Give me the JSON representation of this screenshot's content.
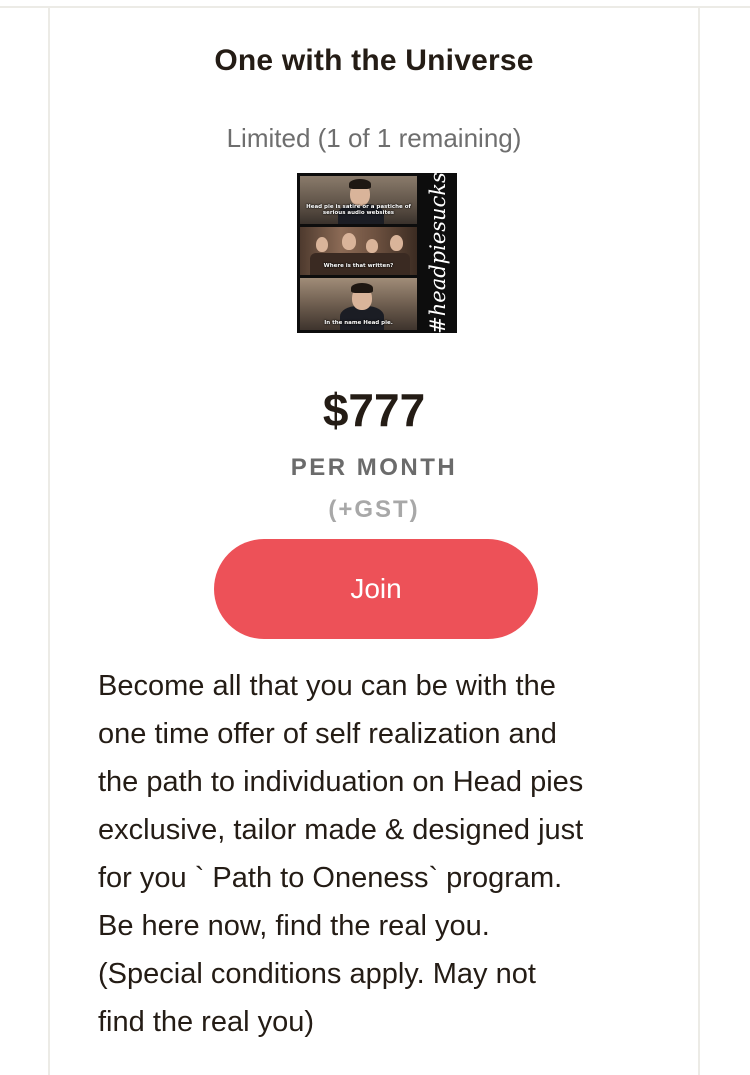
{
  "tier": {
    "title": "One with the Universe",
    "availability": "Limited (1 of 1 remaining)",
    "image": {
      "captions": [
        "Head pie is satire or a pastiche of serious audio websites",
        "Where is that written?",
        "In the name Head pie."
      ],
      "hashtag": "#headpiesucks"
    },
    "price": "$777",
    "period": "PER MONTH",
    "tax_note": "(+GST)",
    "join_label": "Join",
    "description": "Become all that you can be with the\none time offer of self realization and\nthe path to individuation on Head pies\nexclusive, tailor made & designed just\nfor you ` Path to Oneness` program.\nBe here now, find the real you.\n(Special conditions apply. May not\nfind the real you)"
  },
  "colors": {
    "join_button": "#ed5158",
    "title_text": "#241c15",
    "muted_text": "#6e6e6e",
    "card_border": "#ecebe6"
  }
}
